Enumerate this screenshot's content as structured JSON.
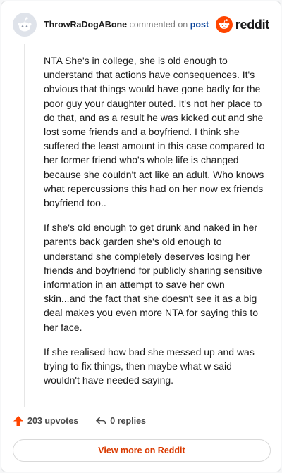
{
  "header": {
    "username": "ThrowRaDogABone",
    "action": "commented on",
    "post_link": "post",
    "brand": "reddit"
  },
  "comment": {
    "paragraphs": [
      "NTA She's in college, she is old enough to understand that actions have consequences. It's obvious that things would have gone badly for the poor guy your daughter outed. It's not her place to do that, and as a result he was kicked out and she lost some friends and a boyfriend. I think she suffered the least amount in this case compared to her former friend who's whole life is changed because she couldn't act like an adult. Who knows what repercussions this had on her now ex friends boyfriend too..",
      "If she's old enough to get drunk and naked in her parents back garden she's old enough to understand she completely deserves losing her friends and boyfriend for publicly sharing sensitive information in an attempt to save her own skin...and the fact that she doesn't see it as a big deal makes you even more NTA for saying this to her face.",
      "If she realised how bad she messed up and was trying to fix things, then maybe what w said wouldn't have needed saying."
    ]
  },
  "footer": {
    "upvotes": "203 upvotes",
    "replies": "0 replies"
  },
  "view_more_label": "View more on Reddit",
  "icons": {
    "avatar": "snoo-avatar-icon",
    "brand": "reddit-logo-icon",
    "upvote": "upvote-arrow-icon",
    "reply": "reply-arrow-icon"
  },
  "colors": {
    "brand_orange": "#ff4500",
    "link_blue": "#0a449b",
    "view_more": "#d93a00"
  }
}
